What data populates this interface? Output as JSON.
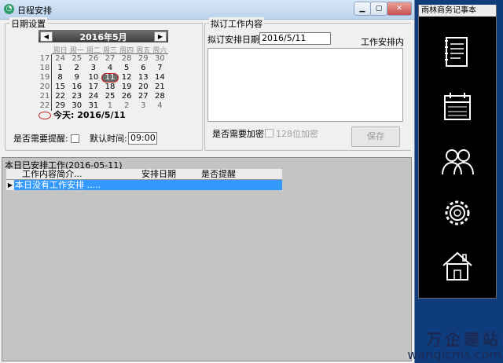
{
  "window": {
    "title": "日程安排"
  },
  "date_section": {
    "legend": "日期设置",
    "calendar": {
      "month_title": "2016年5月",
      "weekdays": [
        "周日",
        "周一",
        "周二",
        "周三",
        "周四",
        "周五",
        "周六"
      ],
      "weeknums": [
        "17",
        "18",
        "19",
        "20",
        "21",
        "22"
      ],
      "days": [
        {
          "d": "24",
          "t": "other"
        },
        {
          "d": "25",
          "t": "other"
        },
        {
          "d": "26",
          "t": "other"
        },
        {
          "d": "27",
          "t": "other"
        },
        {
          "d": "28",
          "t": "other"
        },
        {
          "d": "29",
          "t": "other"
        },
        {
          "d": "30",
          "t": "other"
        },
        {
          "d": "1",
          "t": "cur"
        },
        {
          "d": "2",
          "t": "cur"
        },
        {
          "d": "3",
          "t": "cur"
        },
        {
          "d": "4",
          "t": "cur"
        },
        {
          "d": "5",
          "t": "cur"
        },
        {
          "d": "6",
          "t": "cur"
        },
        {
          "d": "7",
          "t": "cur"
        },
        {
          "d": "8",
          "t": "cur"
        },
        {
          "d": "9",
          "t": "cur"
        },
        {
          "d": "10",
          "t": "cur"
        },
        {
          "d": "11",
          "t": "today"
        },
        {
          "d": "12",
          "t": "cur"
        },
        {
          "d": "13",
          "t": "cur"
        },
        {
          "d": "14",
          "t": "cur"
        },
        {
          "d": "15",
          "t": "cur"
        },
        {
          "d": "16",
          "t": "cur"
        },
        {
          "d": "17",
          "t": "cur"
        },
        {
          "d": "18",
          "t": "cur"
        },
        {
          "d": "19",
          "t": "cur"
        },
        {
          "d": "20",
          "t": "cur"
        },
        {
          "d": "21",
          "t": "cur"
        },
        {
          "d": "22",
          "t": "cur"
        },
        {
          "d": "23",
          "t": "cur"
        },
        {
          "d": "24",
          "t": "cur"
        },
        {
          "d": "25",
          "t": "cur"
        },
        {
          "d": "26",
          "t": "cur"
        },
        {
          "d": "27",
          "t": "cur"
        },
        {
          "d": "28",
          "t": "cur"
        },
        {
          "d": "29",
          "t": "cur"
        },
        {
          "d": "30",
          "t": "cur"
        },
        {
          "d": "31",
          "t": "cur"
        },
        {
          "d": "1",
          "t": "other"
        },
        {
          "d": "2",
          "t": "other"
        },
        {
          "d": "3",
          "t": "other"
        },
        {
          "d": "4",
          "t": "other"
        }
      ],
      "today_text": "今天: 2016/5/11"
    },
    "remind_label": "是否需要提醒:",
    "default_time_label": "默认时间:",
    "default_time_value": "09:00"
  },
  "plan_section": {
    "legend": "拟订工作内容",
    "date_label": "拟订安排日期:",
    "date_value": "2016/5/11",
    "content_label": "工作安排内容:",
    "encrypt_label": "是否需要加密:",
    "encrypt128_label": "128位加密",
    "save_label": "保存"
  },
  "today_work": {
    "legend": "本日已安排工作(2016-05-11)",
    "columns": [
      "工作内容简介...",
      "安排日期",
      "是否提醒"
    ],
    "rows": [
      {
        "text": "本日没有工作安排 ....."
      }
    ]
  },
  "side_panel": {
    "title": "雨林商务记事本",
    "icons": [
      "notebook-icon",
      "calendar-icon",
      "people-icon",
      "gear-icon",
      "house-icon"
    ]
  },
  "footer_logo": {
    "cn": "万企建站",
    "url": "wanqicms.com"
  },
  "colors": {
    "selection": "#3399ff",
    "today_ring": "#c82020",
    "side_bg": "#000000"
  }
}
